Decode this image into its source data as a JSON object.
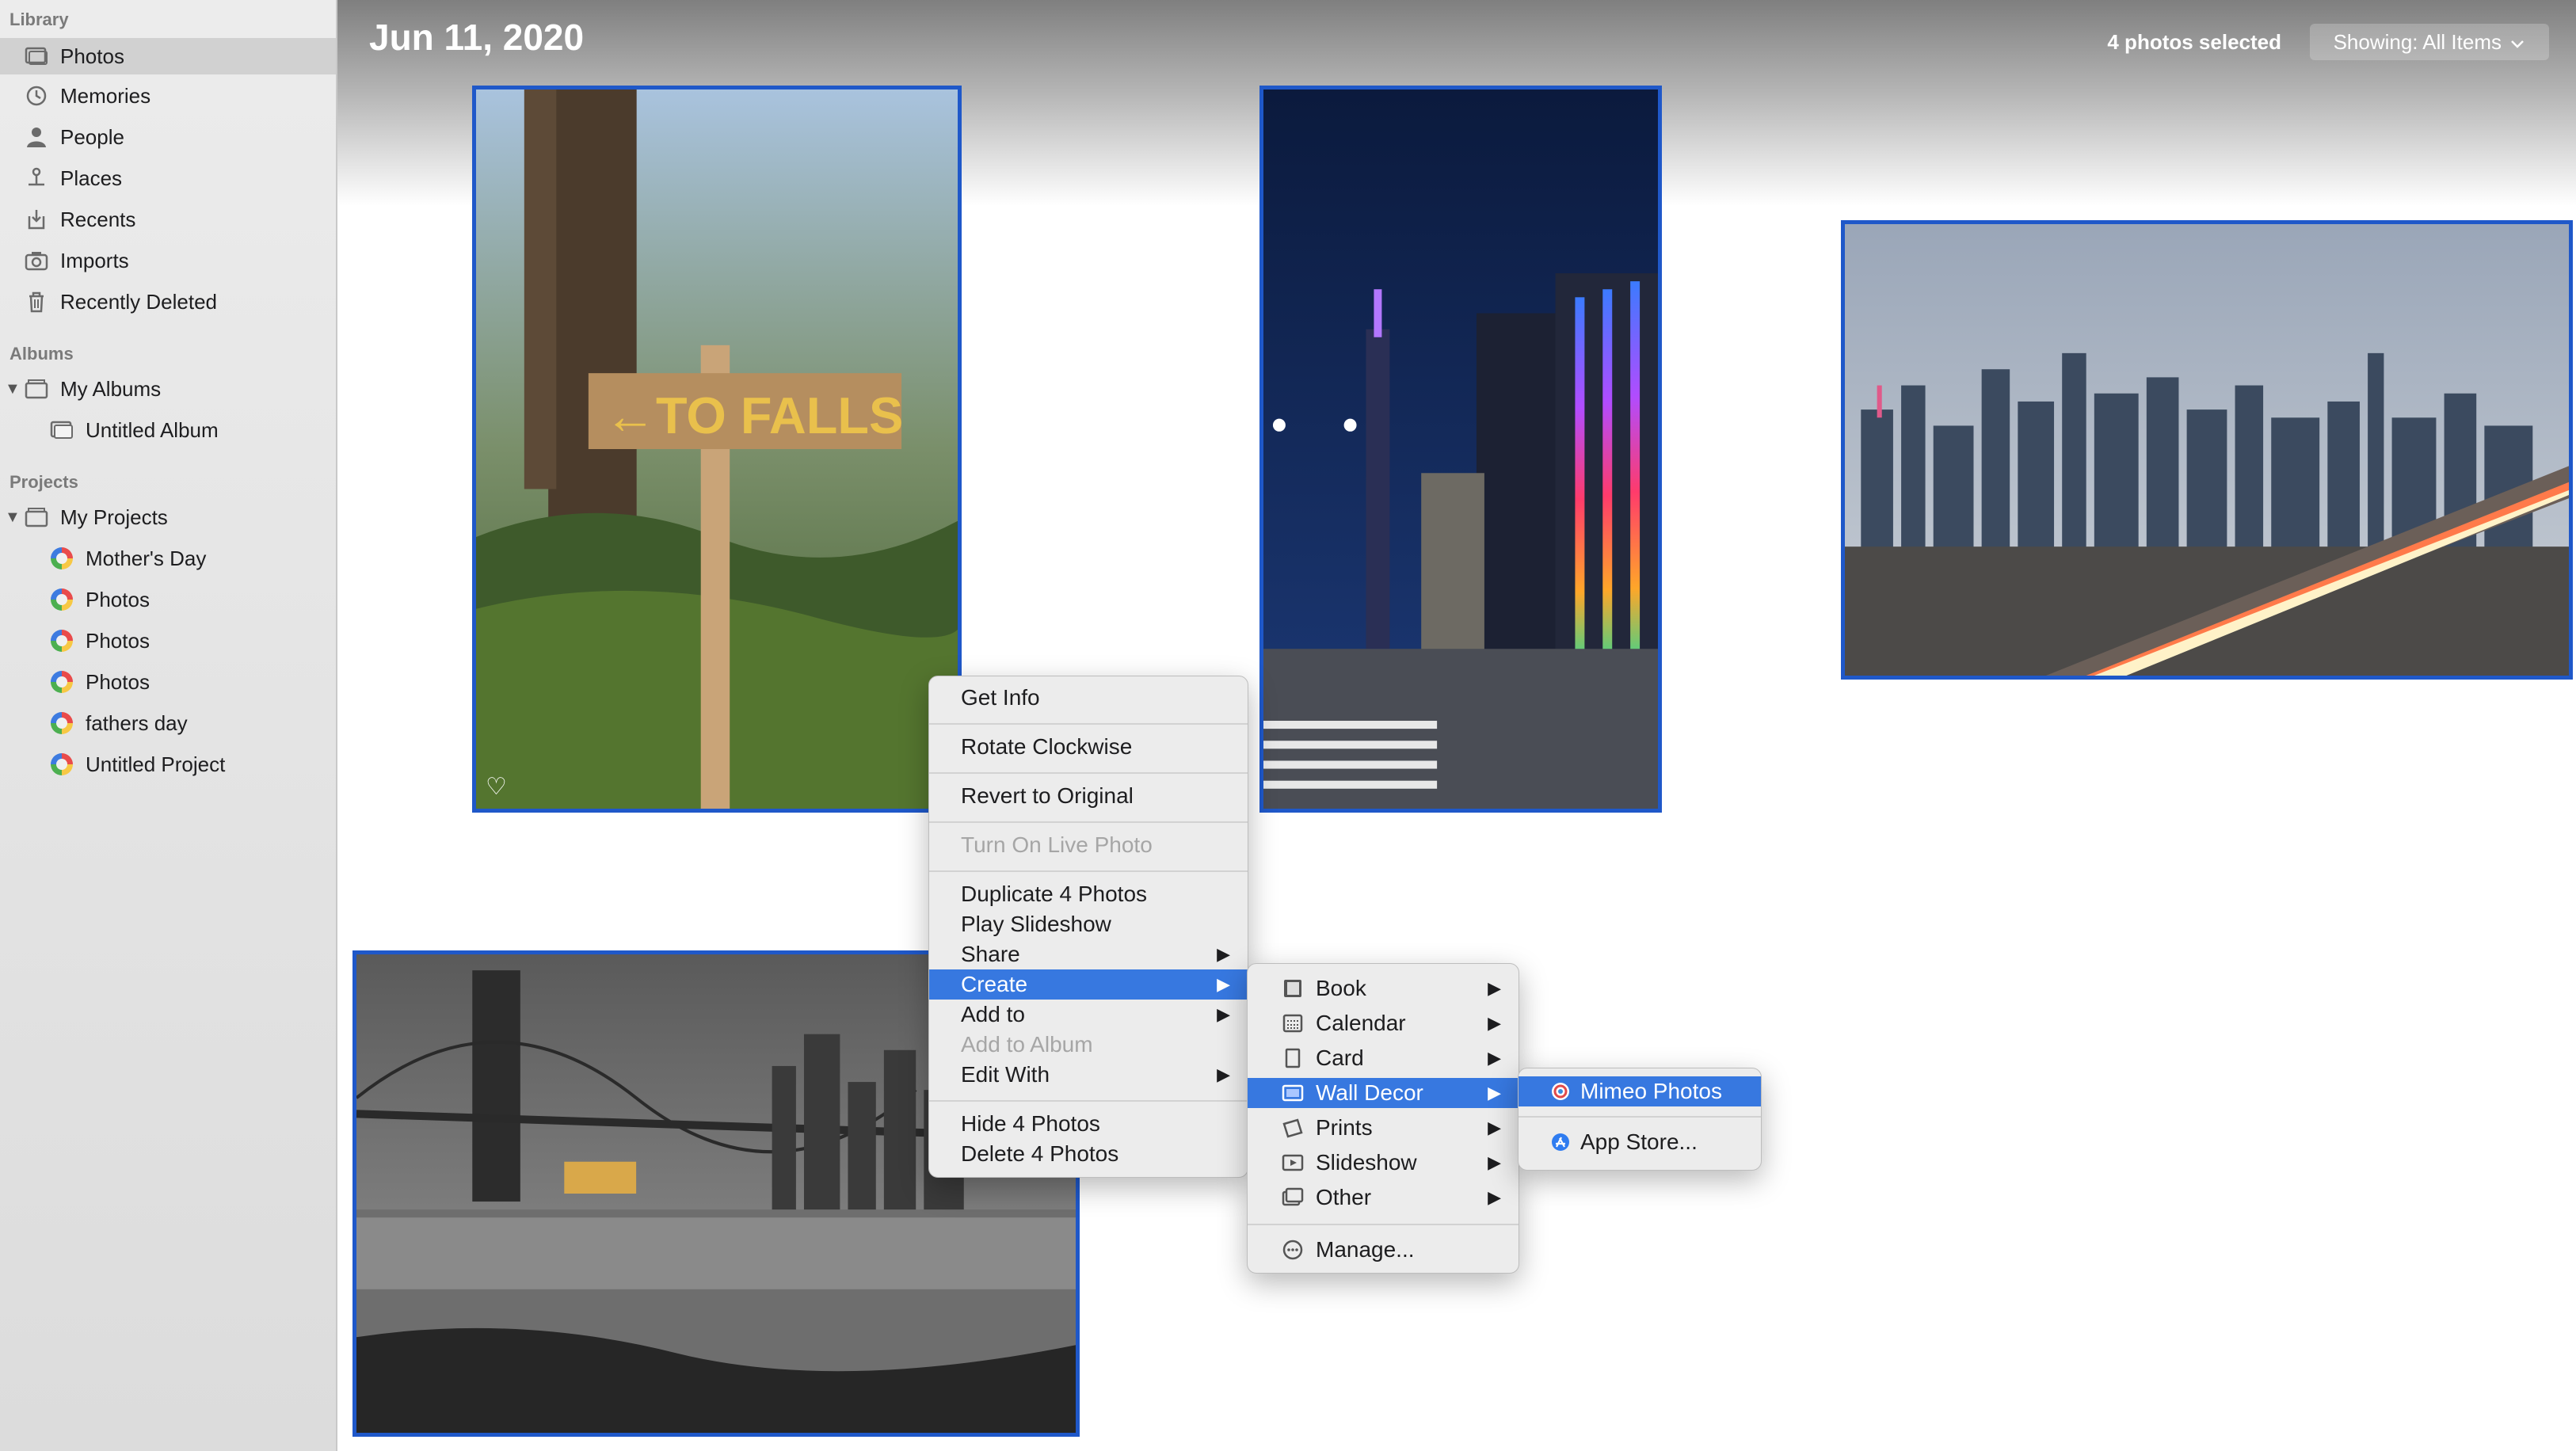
{
  "sidebar": {
    "library_title": "Library",
    "library_items": [
      {
        "label": "Photos",
        "icon": "photos-icon"
      },
      {
        "label": "Memories",
        "icon": "memories-icon"
      },
      {
        "label": "People",
        "icon": "person-icon"
      },
      {
        "label": "Places",
        "icon": "pin-icon"
      },
      {
        "label": "Recents",
        "icon": "recents-icon"
      },
      {
        "label": "Imports",
        "icon": "camera-icon"
      },
      {
        "label": "Recently Deleted",
        "icon": "trash-icon"
      }
    ],
    "albums_title": "Albums",
    "albums": [
      {
        "label": "My Albums",
        "icon": "folder-icon"
      },
      {
        "label": "Untitled Album",
        "icon": "album-icon"
      }
    ],
    "projects_title": "Projects",
    "projects": [
      {
        "label": "My Projects",
        "icon": "folder-icon"
      },
      {
        "label": "Mother's Day"
      },
      {
        "label": "Photos"
      },
      {
        "label": "Photos"
      },
      {
        "label": "Photos"
      },
      {
        "label": "fathers day"
      },
      {
        "label": "Untitled Project"
      }
    ]
  },
  "header": {
    "date": "Jun 11, 2020",
    "selection_count": "4 photos selected",
    "showing": "Showing: All Items"
  },
  "context_menu": {
    "items": [
      {
        "label": "Get Info"
      },
      {
        "label": "Rotate Clockwise"
      },
      {
        "label": "Revert to Original"
      },
      {
        "label": "Turn On Live Photo",
        "disabled": true
      },
      {
        "label": "Duplicate 4 Photos"
      },
      {
        "label": "Play Slideshow"
      },
      {
        "label": "Share",
        "submenu": true
      },
      {
        "label": "Create",
        "submenu": true,
        "highlighted": true
      },
      {
        "label": "Add to",
        "submenu": true
      },
      {
        "label": "Add to Album",
        "disabled": true
      },
      {
        "label": "Edit With",
        "submenu": true
      },
      {
        "label": "Hide 4 Photos"
      },
      {
        "label": "Delete 4 Photos"
      }
    ]
  },
  "create_menu": {
    "items": [
      {
        "label": "Book",
        "icon": "book-icon"
      },
      {
        "label": "Calendar",
        "icon": "calendar-icon"
      },
      {
        "label": "Card",
        "icon": "card-icon"
      },
      {
        "label": "Wall Decor",
        "icon": "wall-decor-icon",
        "highlighted": true
      },
      {
        "label": "Prints",
        "icon": "prints-icon"
      },
      {
        "label": "Slideshow",
        "icon": "slideshow-icon"
      },
      {
        "label": "Other",
        "icon": "other-icon"
      },
      {
        "label": "Manage...",
        "icon": "manage-icon"
      }
    ]
  },
  "wall_decor_menu": {
    "items": [
      {
        "label": "Mimeo Photos",
        "icon": "mimeo-icon"
      },
      {
        "label": "App Store...",
        "icon": "app-store-icon"
      }
    ]
  },
  "colors": {
    "selection_blue": "#1f58c9",
    "menu_highlight": "#3778e0"
  }
}
